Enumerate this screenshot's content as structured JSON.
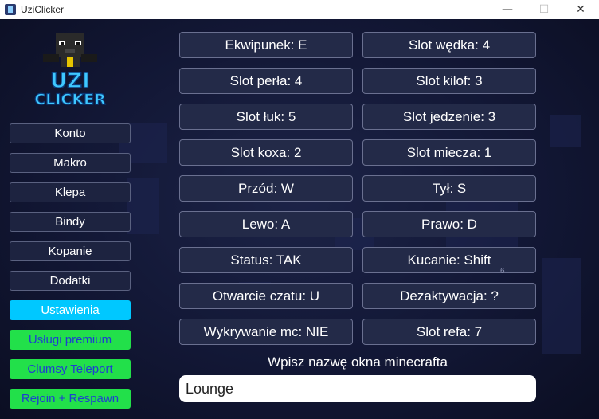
{
  "window": {
    "title": "UziClicker",
    "controls": {
      "minimize": "—",
      "maximize": "☐",
      "close": "✕"
    }
  },
  "logo": {
    "text_line1": "UZI",
    "text_line2": "CLICKER",
    "icon": "uzi-clicker-logo"
  },
  "sidebar": {
    "items": [
      {
        "label": "Konto",
        "style": "default"
      },
      {
        "label": "Makro",
        "style": "default"
      },
      {
        "label": "Klepa",
        "style": "default"
      },
      {
        "label": "Bindy",
        "style": "default"
      },
      {
        "label": "Kopanie",
        "style": "default"
      },
      {
        "label": "Dodatki",
        "style": "default"
      },
      {
        "label": "Ustawienia",
        "style": "active"
      },
      {
        "label": "Usługi premium",
        "style": "green"
      },
      {
        "label": "Clumsy Teleport",
        "style": "green"
      },
      {
        "label": "Rejoin + Respawn",
        "style": "green"
      }
    ]
  },
  "settings": {
    "left": [
      "Ekwipunek: E",
      "Slot perła: 4",
      "Slot łuk: 5",
      "Slot koxa: 2",
      "Przód: W",
      "Lewo: A",
      "Status: TAK",
      "Otwarcie czatu: U",
      "Wykrywanie mc: NIE"
    ],
    "right": [
      "Slot wędka: 4",
      "Slot kilof: 3",
      "Slot jedzenie: 3",
      "Slot miecza: 1",
      "Tył: S",
      "Prawo: D",
      "Kucanie: Shift",
      "Dezaktywacja: ?",
      "Slot refa: 7"
    ],
    "stray_text": "6"
  },
  "window_name": {
    "prompt": "Wpisz nazwę okna minecrafta",
    "value": "Lounge"
  },
  "colors": {
    "active": "#00c8ff",
    "premium": "#22e04a",
    "premium_text": "#1e3fd0",
    "background": "#121735"
  }
}
